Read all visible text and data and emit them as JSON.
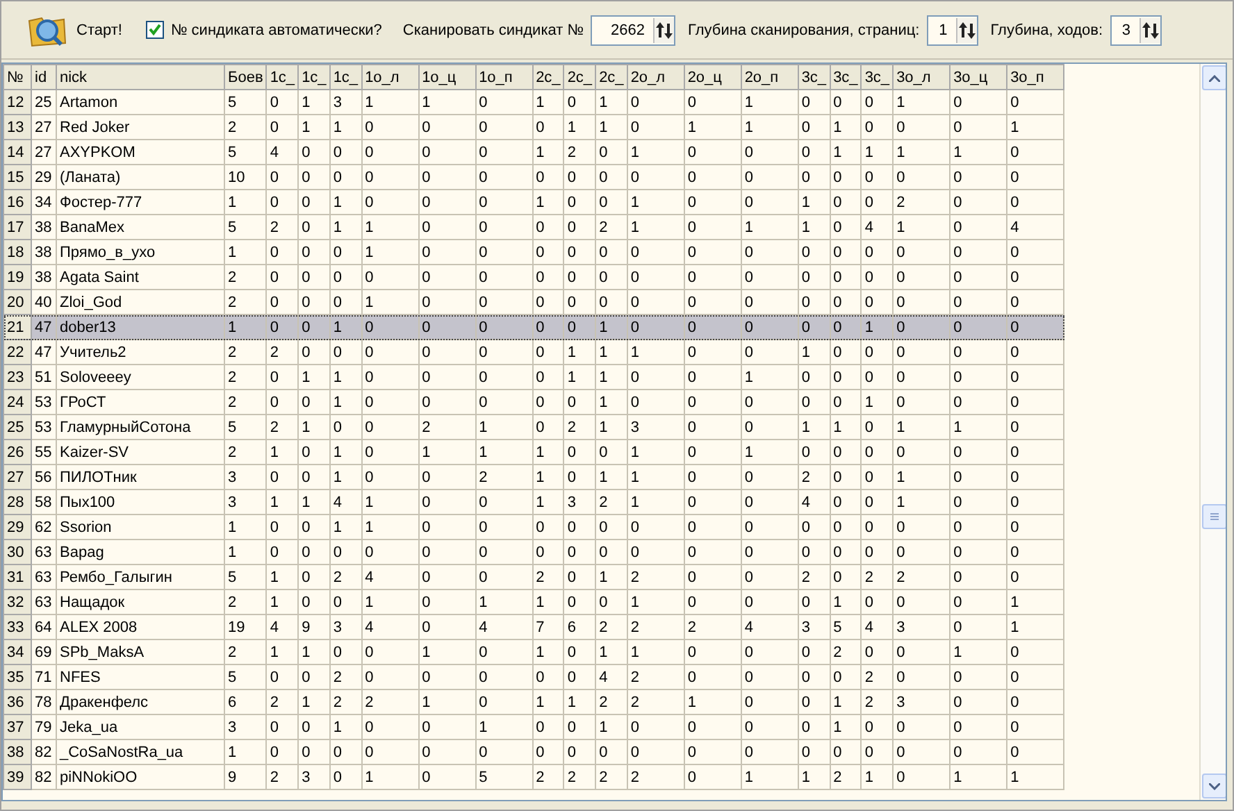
{
  "toolbar": {
    "start_button": "Старт!",
    "auto_checkbox": {
      "label": "№ синдиката автоматически?",
      "checked": true
    },
    "spinners": [
      {
        "label": "Сканировать синдикат №",
        "value": "2662"
      },
      {
        "label": "Глубина сканирования, страниц:",
        "value": "1"
      },
      {
        "label": "Глубина, ходов:",
        "value": "3"
      }
    ]
  },
  "table": {
    "columns": [
      "№",
      "id",
      "nick",
      "Боев",
      "1с_",
      "1с_",
      "1с_",
      "1о_л",
      "1о_ц",
      "1о_п",
      "2с_",
      "2с_",
      "2с_",
      "2о_л",
      "2о_ц",
      "2о_п",
      "3с_",
      "3с_",
      "3с_",
      "3о_л",
      "3о_ц",
      "3о_п"
    ],
    "rows": [
      {
        "selected": false,
        "cells": [
          "12",
          "25",
          "Artamon",
          "5",
          "0",
          "1",
          "3",
          "1",
          "1",
          "0",
          "1",
          "0",
          "1",
          "0",
          "0",
          "1",
          "0",
          "0",
          "0",
          "1",
          "0",
          "0"
        ]
      },
      {
        "selected": false,
        "cells": [
          "13",
          "27",
          "Red Joker",
          "2",
          "0",
          "1",
          "1",
          "0",
          "0",
          "0",
          "0",
          "1",
          "1",
          "0",
          "1",
          "1",
          "0",
          "1",
          "0",
          "0",
          "0",
          "1"
        ]
      },
      {
        "selected": false,
        "cells": [
          "14",
          "27",
          "AXYPKOM",
          "5",
          "4",
          "0",
          "0",
          "0",
          "0",
          "0",
          "1",
          "2",
          "0",
          "1",
          "0",
          "0",
          "0",
          "1",
          "1",
          "1",
          "1",
          "0"
        ]
      },
      {
        "selected": false,
        "cells": [
          "15",
          "29",
          "(Ланата)",
          "10",
          "0",
          "0",
          "0",
          "0",
          "0",
          "0",
          "0",
          "0",
          "0",
          "0",
          "0",
          "0",
          "0",
          "0",
          "0",
          "0",
          "0",
          "0"
        ]
      },
      {
        "selected": false,
        "cells": [
          "16",
          "34",
          "Фостер-777",
          "1",
          "0",
          "0",
          "1",
          "0",
          "0",
          "0",
          "1",
          "0",
          "0",
          "1",
          "0",
          "0",
          "1",
          "0",
          "0",
          "2",
          "0",
          "0"
        ]
      },
      {
        "selected": false,
        "cells": [
          "17",
          "38",
          "BanaMex",
          "5",
          "2",
          "0",
          "1",
          "1",
          "0",
          "0",
          "0",
          "0",
          "2",
          "1",
          "0",
          "1",
          "1",
          "0",
          "4",
          "1",
          "0",
          "4"
        ]
      },
      {
        "selected": false,
        "cells": [
          "18",
          "38",
          "Прямо_в_ухо",
          "1",
          "0",
          "0",
          "0",
          "1",
          "0",
          "0",
          "0",
          "0",
          "0",
          "0",
          "0",
          "0",
          "0",
          "0",
          "0",
          "0",
          "0",
          "0"
        ]
      },
      {
        "selected": false,
        "cells": [
          "19",
          "38",
          "Agata Saint",
          "2",
          "0",
          "0",
          "0",
          "0",
          "0",
          "0",
          "0",
          "0",
          "0",
          "0",
          "0",
          "0",
          "0",
          "0",
          "0",
          "0",
          "0",
          "0"
        ]
      },
      {
        "selected": false,
        "cells": [
          "20",
          "40",
          "Zloi_God",
          "2",
          "0",
          "0",
          "0",
          "1",
          "0",
          "0",
          "0",
          "0",
          "0",
          "0",
          "0",
          "0",
          "0",
          "0",
          "0",
          "0",
          "0",
          "0"
        ]
      },
      {
        "selected": true,
        "cells": [
          "21",
          "47",
          "dober13",
          "1",
          "0",
          "0",
          "1",
          "0",
          "0",
          "0",
          "0",
          "0",
          "1",
          "0",
          "0",
          "0",
          "0",
          "0",
          "1",
          "0",
          "0",
          "0"
        ]
      },
      {
        "selected": false,
        "cells": [
          "22",
          "47",
          "Учитель2",
          "2",
          "2",
          "0",
          "0",
          "0",
          "0",
          "0",
          "0",
          "1",
          "1",
          "1",
          "0",
          "0",
          "1",
          "0",
          "0",
          "0",
          "0",
          "0"
        ]
      },
      {
        "selected": false,
        "cells": [
          "23",
          "51",
          "Soloveeey",
          "2",
          "0",
          "1",
          "1",
          "0",
          "0",
          "0",
          "0",
          "1",
          "1",
          "0",
          "0",
          "1",
          "0",
          "0",
          "0",
          "0",
          "0",
          "0"
        ]
      },
      {
        "selected": false,
        "cells": [
          "24",
          "53",
          "ГРоСТ",
          "2",
          "0",
          "0",
          "1",
          "0",
          "0",
          "0",
          "0",
          "0",
          "1",
          "0",
          "0",
          "0",
          "0",
          "0",
          "1",
          "0",
          "0",
          "0"
        ]
      },
      {
        "selected": false,
        "cells": [
          "25",
          "53",
          "ГламурныйСотона",
          "5",
          "2",
          "1",
          "0",
          "0",
          "2",
          "1",
          "0",
          "2",
          "1",
          "3",
          "0",
          "0",
          "1",
          "1",
          "0",
          "1",
          "1",
          "0"
        ]
      },
      {
        "selected": false,
        "cells": [
          "26",
          "55",
          "Kaizer-SV",
          "2",
          "1",
          "0",
          "1",
          "0",
          "1",
          "1",
          "1",
          "0",
          "0",
          "1",
          "0",
          "1",
          "0",
          "0",
          "0",
          "0",
          "0",
          "0"
        ]
      },
      {
        "selected": false,
        "cells": [
          "27",
          "56",
          "ПИЛОТник",
          "3",
          "0",
          "0",
          "1",
          "0",
          "0",
          "2",
          "1",
          "0",
          "1",
          "1",
          "0",
          "0",
          "2",
          "0",
          "0",
          "1",
          "0",
          "0"
        ]
      },
      {
        "selected": false,
        "cells": [
          "28",
          "58",
          "Пых100",
          "3",
          "1",
          "1",
          "4",
          "1",
          "0",
          "0",
          "1",
          "3",
          "2",
          "1",
          "0",
          "0",
          "4",
          "0",
          "0",
          "1",
          "0",
          "0"
        ]
      },
      {
        "selected": false,
        "cells": [
          "29",
          "62",
          "Ssorion",
          "1",
          "0",
          "0",
          "1",
          "1",
          "0",
          "0",
          "0",
          "0",
          "0",
          "0",
          "0",
          "0",
          "0",
          "0",
          "0",
          "0",
          "0",
          "0"
        ]
      },
      {
        "selected": false,
        "cells": [
          "30",
          "63",
          "Bapag",
          "1",
          "0",
          "0",
          "0",
          "0",
          "0",
          "0",
          "0",
          "0",
          "0",
          "0",
          "0",
          "0",
          "0",
          "0",
          "0",
          "0",
          "0",
          "0"
        ]
      },
      {
        "selected": false,
        "cells": [
          "31",
          "63",
          "Рембо_Галыгин",
          "5",
          "1",
          "0",
          "2",
          "4",
          "0",
          "0",
          "2",
          "0",
          "1",
          "2",
          "0",
          "0",
          "2",
          "0",
          "2",
          "2",
          "0",
          "0"
        ]
      },
      {
        "selected": false,
        "cells": [
          "32",
          "63",
          "Нащадок",
          "2",
          "1",
          "0",
          "0",
          "1",
          "0",
          "1",
          "1",
          "0",
          "0",
          "1",
          "0",
          "0",
          "0",
          "1",
          "0",
          "0",
          "0",
          "1"
        ]
      },
      {
        "selected": false,
        "cells": [
          "33",
          "64",
          "ALEX 2008",
          "19",
          "4",
          "9",
          "3",
          "4",
          "0",
          "4",
          "7",
          "6",
          "2",
          "2",
          "2",
          "4",
          "3",
          "5",
          "4",
          "3",
          "0",
          "1"
        ]
      },
      {
        "selected": false,
        "cells": [
          "34",
          "69",
          "SPb_MaksA",
          "2",
          "1",
          "1",
          "0",
          "0",
          "1",
          "0",
          "1",
          "0",
          "1",
          "1",
          "0",
          "0",
          "0",
          "2",
          "0",
          "0",
          "1",
          "0"
        ]
      },
      {
        "selected": false,
        "cells": [
          "35",
          "71",
          "NFES",
          "5",
          "0",
          "0",
          "2",
          "0",
          "0",
          "0",
          "0",
          "0",
          "4",
          "2",
          "0",
          "0",
          "0",
          "0",
          "2",
          "0",
          "0",
          "0"
        ]
      },
      {
        "selected": false,
        "cells": [
          "36",
          "78",
          "Дракенфелс",
          "6",
          "2",
          "1",
          "2",
          "2",
          "1",
          "0",
          "1",
          "1",
          "2",
          "2",
          "1",
          "0",
          "0",
          "1",
          "2",
          "3",
          "0",
          "0"
        ]
      },
      {
        "selected": false,
        "cells": [
          "37",
          "79",
          "Jeka_ua",
          "3",
          "0",
          "0",
          "1",
          "0",
          "0",
          "1",
          "0",
          "0",
          "1",
          "0",
          "0",
          "0",
          "0",
          "1",
          "0",
          "0",
          "0",
          "0"
        ]
      },
      {
        "selected": false,
        "cells": [
          "38",
          "82",
          "_CoSaNostRa_ua",
          "1",
          "0",
          "0",
          "0",
          "0",
          "0",
          "0",
          "0",
          "0",
          "0",
          "0",
          "0",
          "0",
          "0",
          "0",
          "0",
          "0",
          "0",
          "0"
        ]
      },
      {
        "selected": false,
        "cells": [
          "39",
          "82",
          "piNNokiOO",
          "9",
          "2",
          "3",
          "0",
          "1",
          "0",
          "5",
          "2",
          "2",
          "2",
          "2",
          "0",
          "1",
          "1",
          "2",
          "1",
          "0",
          "1",
          "1"
        ]
      }
    ]
  }
}
